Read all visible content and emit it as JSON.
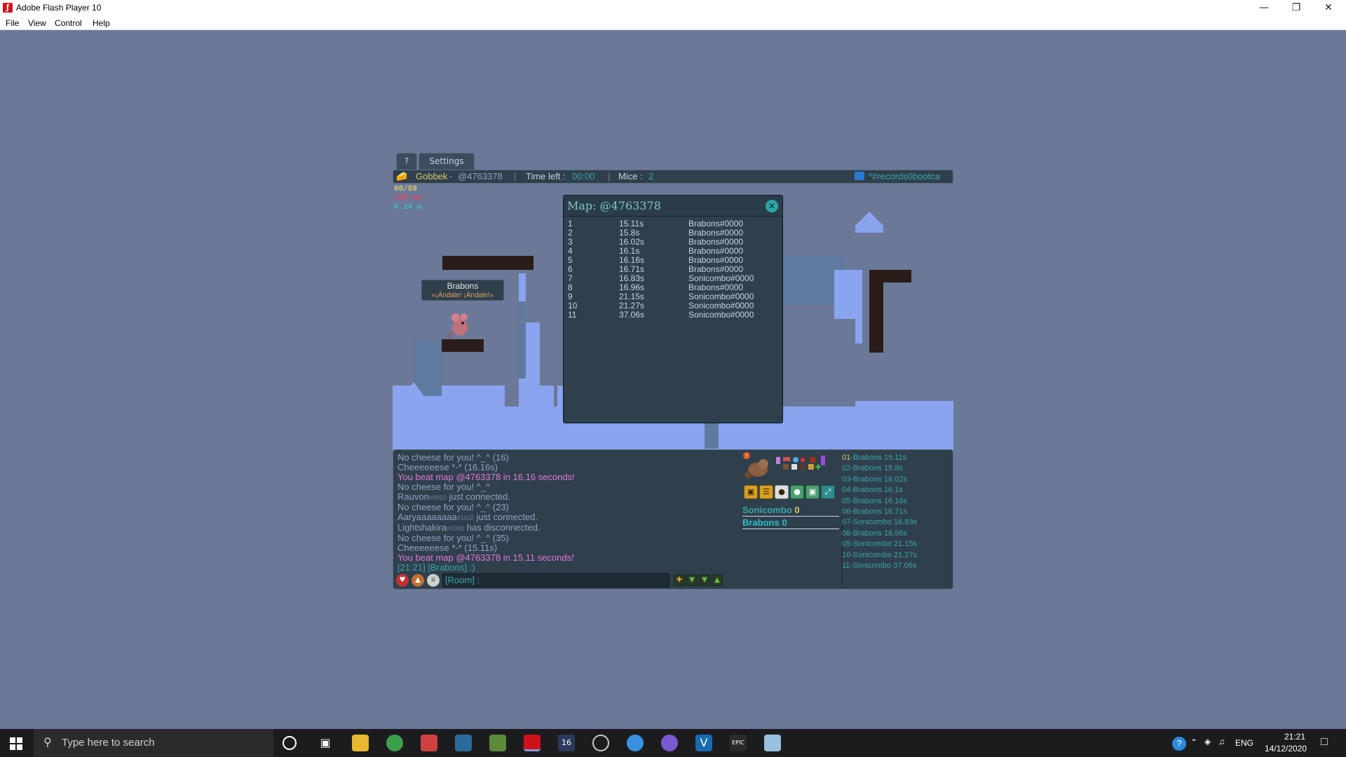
{
  "window": {
    "title": "Adobe Flash Player 10",
    "menu": [
      "File",
      "View",
      "Control",
      "Help"
    ]
  },
  "game": {
    "tabs": [
      "?",
      "Settings"
    ],
    "topbar": {
      "player": "Gobbek",
      "player_sep": " - ",
      "map_code": "@4763378",
      "time_label": "Time left :",
      "time_value": "00:00",
      "mice_label": "Mice :",
      "mice_value": "2",
      "room": "*#records0bootca"
    },
    "stats": [
      "60/59",
      "128 mo",
      "0.14 m"
    ],
    "player_label": {
      "name": "Brabons",
      "quote": "«¡Ándale! ¡Ándale!»"
    },
    "map_dialog": {
      "title": "Map: @4763378",
      "rows": [
        {
          "rank": "1",
          "time": "15.11s",
          "player": "Brabons#0000"
        },
        {
          "rank": "2",
          "time": "15.8s",
          "player": "Brabons#0000"
        },
        {
          "rank": "3",
          "time": "16.02s",
          "player": "Brabons#0000"
        },
        {
          "rank": "4",
          "time": "16.1s",
          "player": "Brabons#0000"
        },
        {
          "rank": "5",
          "time": "16.16s",
          "player": "Brabons#0000"
        },
        {
          "rank": "6",
          "time": "16.71s",
          "player": "Brabons#0000"
        },
        {
          "rank": "7",
          "time": "16.83s",
          "player": "Sonicombo#0000"
        },
        {
          "rank": "8",
          "time": "16.96s",
          "player": "Brabons#0000"
        },
        {
          "rank": "9",
          "time": "21.15s",
          "player": "Sonicombo#0000"
        },
        {
          "rank": "10",
          "time": "21.27s",
          "player": "Sonicombo#0000"
        },
        {
          "rank": "11",
          "time": "37.06s",
          "player": "Sonicombo#0000"
        }
      ]
    },
    "chat": [
      {
        "text": "No cheese for you! ^_^ (16)",
        "color": "grey"
      },
      {
        "text": "Cheeeeeese *-* (16.16s)",
        "color": "grey"
      },
      {
        "text": "You beat map @4763378 in 16.16 seconds!",
        "color": "pink"
      },
      {
        "text": "No cheese for you! ^_^",
        "color": "grey"
      },
      {
        "name": "Rauvon",
        "tag": "#9910",
        "text": " just connected.",
        "color": "grey"
      },
      {
        "text": "No cheese for you! ^_^ (23)",
        "color": "grey"
      },
      {
        "name": "Aaryaaaaaaaa",
        "tag": "#1102",
        "text": " just connected.",
        "color": "grey"
      },
      {
        "name": "Lightshakira",
        "tag": "#0000",
        "text": " has disconnected.",
        "color": "grey"
      },
      {
        "text": "No cheese for you! ^_^ (35)",
        "color": "grey"
      },
      {
        "text": "Cheeeeeese *-* (15.11s)",
        "color": "grey"
      },
      {
        "text": "You beat map @4763378 in 15.11 seconds!",
        "color": "pink"
      },
      {
        "text": "[21:21] [Brabons] :)",
        "color": "teal"
      }
    ],
    "chat_input": {
      "prefix": "[Room] :"
    },
    "scores": [
      {
        "name": "Sonicombo",
        "score": "0",
        "color": "#3aa6a6"
      },
      {
        "name": "Brabons",
        "score": "0",
        "color": "#2ac0c8"
      }
    ],
    "ranking": [
      {
        "num": "01",
        "name": "Brabons",
        "time": "15.11s"
      },
      {
        "num": "02",
        "name": "Brabons",
        "time": "15.8s"
      },
      {
        "num": "03",
        "name": "Brabons",
        "time": "16.02s"
      },
      {
        "num": "04",
        "name": "Brabons",
        "time": "16.1s"
      },
      {
        "num": "05",
        "name": "Brabons",
        "time": "16.16s"
      },
      {
        "num": "06",
        "name": "Brabons",
        "time": "16.71s"
      },
      {
        "num": "07",
        "name": "Sonicombo",
        "time": "16.83s"
      },
      {
        "num": "08",
        "name": "Brabons",
        "time": "16.96s"
      },
      {
        "num": "09",
        "name": "Sonicombo",
        "time": "21.15s"
      },
      {
        "num": "10",
        "name": "Sonicombo",
        "time": "21.27s"
      },
      {
        "num": "11",
        "name": "Sonicombo",
        "time": "37.06s"
      }
    ]
  },
  "taskbar": {
    "search_placeholder": "Type here to search",
    "language": "ENG",
    "time": "21:21",
    "date": "14/12/2020"
  },
  "colors": {
    "background": "#6b7898",
    "panel": "#2f3f4c",
    "teal": "#3aa6a6",
    "pink": "#e07ad8",
    "ground_light": "#8aa4f0",
    "ground_dark": "#2a1c18"
  }
}
